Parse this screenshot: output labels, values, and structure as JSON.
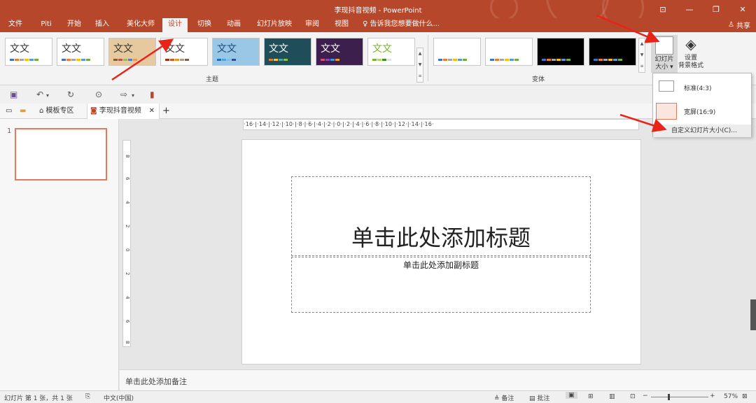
{
  "window": {
    "title": "李现抖音视频 - PowerPoint",
    "controls": [
      "⊡",
      "—",
      "❐",
      "✕"
    ]
  },
  "ribbon_tabs": [
    "文件",
    "Piti",
    "开始",
    "插入",
    "美化大师",
    "设计",
    "切换",
    "动画",
    "幻灯片放映",
    "审阅",
    "视图"
  ],
  "active_tab": "设计",
  "tell_me": "告诉我您想要做什么...",
  "share": "共享",
  "themes": {
    "label": "主题",
    "items": [
      {
        "text": "文文",
        "bg": "#ffffff",
        "fg": "#222222"
      },
      {
        "text": "文文",
        "bg": "#ffffff",
        "fg": "#222222"
      },
      {
        "text": "文文",
        "bg": "#e7c9a0",
        "fg": "#222222"
      },
      {
        "text": "文文",
        "bg": "#ffffff",
        "fg": "#222222"
      },
      {
        "text": "文文",
        "bg": "#9bc7e6",
        "fg": "#1d4a78"
      },
      {
        "text": "文文",
        "bg": "#1f4e5a",
        "fg": "#ffffff"
      },
      {
        "text": "文文",
        "bg": "#3c1f4d",
        "fg": "#ffffff"
      },
      {
        "text": "文文",
        "bg": "#ffffff",
        "fg": "#7bb32e"
      }
    ]
  },
  "variants": {
    "label": "变体",
    "items": [
      {
        "bg": "#ffffff"
      },
      {
        "bg": "#ffffff"
      },
      {
        "bg": "#000000"
      },
      {
        "bg": "#000000"
      }
    ]
  },
  "slide_size_button": "幻灯片\n大小",
  "slide_size_line1": "幻灯片",
  "slide_size_line2": "大小",
  "format_bg_line1": "设置",
  "format_bg_line2": "背景格式",
  "dropdown": {
    "standard": "标准(4:3)",
    "widescreen": "宽屏(16:9)",
    "custom": "自定义幻灯片大小(C)..."
  },
  "doc_tabs": {
    "template": "模板专区",
    "document": "李现抖音视频"
  },
  "ruler_h": "·16·|·14·|·12·|·10·|·8·|·6·|·4·|·2·|·0·|·2·|·4·|·6·|·8·|·10·|·12·|·14·|·16·",
  "ruler_v": [
    "8",
    "6",
    "4",
    "2",
    "0",
    "2",
    "4",
    "6",
    "8"
  ],
  "slide": {
    "number": "1",
    "title_placeholder": "单击此处添加标题",
    "subtitle_placeholder": "单击此处添加副标题"
  },
  "notes_placeholder": "单击此处添加备注",
  "status": {
    "slide_info": "幻灯片 第 1 张，共 1 张",
    "language": "中文(中国)",
    "notes": "备注",
    "comments": "批注",
    "zoom": "57%"
  },
  "colors": {
    "accent": "#b7472a",
    "selection": "#e5795a"
  }
}
